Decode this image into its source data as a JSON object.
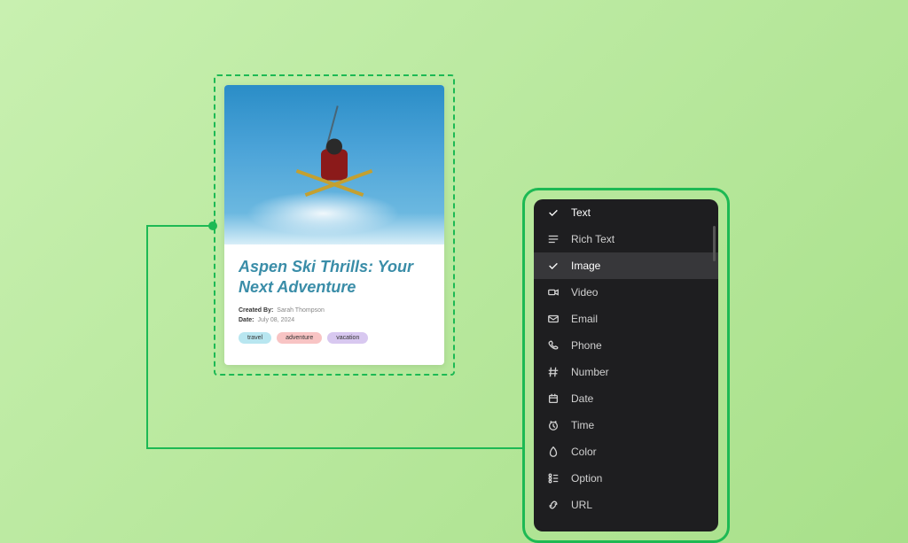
{
  "card": {
    "title": "Aspen Ski Thrills: Your Next Adventure",
    "created_by_label": "Created By:",
    "created_by_value": "Sarah Thompson",
    "date_label": "Date:",
    "date_value": "July 08, 2024",
    "tags": [
      "travel",
      "adventure",
      "vacation"
    ]
  },
  "dropdown": {
    "items": [
      {
        "label": "Text",
        "icon": "check-icon",
        "selected": true,
        "highlighted": false
      },
      {
        "label": "Rich Text",
        "icon": "rich-text-icon",
        "selected": false,
        "highlighted": false
      },
      {
        "label": "Image",
        "icon": "check-icon",
        "selected": true,
        "highlighted": true
      },
      {
        "label": "Video",
        "icon": "video-icon",
        "selected": false,
        "highlighted": false
      },
      {
        "label": "Email",
        "icon": "email-icon",
        "selected": false,
        "highlighted": false
      },
      {
        "label": "Phone",
        "icon": "phone-icon",
        "selected": false,
        "highlighted": false
      },
      {
        "label": "Number",
        "icon": "number-icon",
        "selected": false,
        "highlighted": false
      },
      {
        "label": "Date",
        "icon": "date-icon",
        "selected": false,
        "highlighted": false
      },
      {
        "label": "Time",
        "icon": "time-icon",
        "selected": false,
        "highlighted": false
      },
      {
        "label": "Color",
        "icon": "color-icon",
        "selected": false,
        "highlighted": false
      },
      {
        "label": "Option",
        "icon": "option-icon",
        "selected": false,
        "highlighted": false
      },
      {
        "label": "URL",
        "icon": "url-icon",
        "selected": false,
        "highlighted": false
      }
    ]
  }
}
